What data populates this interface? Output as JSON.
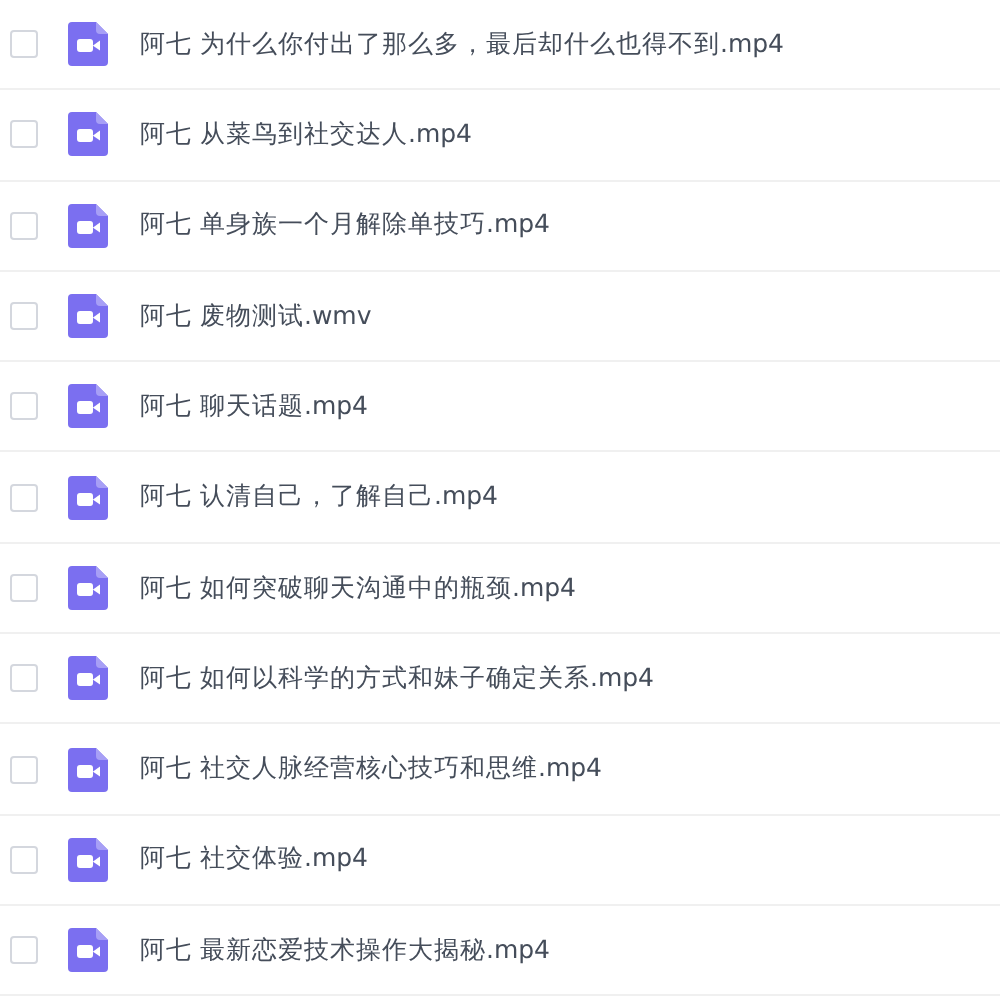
{
  "files": [
    {
      "name": "阿七 为什么你付出了那么多，最后却什么也得不到.mp4",
      "checked": false
    },
    {
      "name": "阿七 从菜鸟到社交达人.mp4",
      "checked": false
    },
    {
      "name": "阿七 单身族一个月解除单技巧.mp4",
      "checked": false
    },
    {
      "name": "阿七 废物测试.wmv",
      "checked": false
    },
    {
      "name": "阿七 聊天话题.mp4",
      "checked": false
    },
    {
      "name": "阿七 认清自己，了解自己.mp4",
      "checked": false
    },
    {
      "name": "阿七 如何突破聊天沟通中的瓶颈.mp4",
      "checked": false
    },
    {
      "name": "阿七 如何以科学的方式和妹子确定关系.mp4",
      "checked": false
    },
    {
      "name": "阿七 社交人脉经营核心技巧和思维.mp4",
      "checked": false
    },
    {
      "name": "阿七 社交体验.mp4",
      "checked": false
    },
    {
      "name": "阿七 最新恋爱技术操作大揭秘.mp4",
      "checked": false
    }
  ]
}
